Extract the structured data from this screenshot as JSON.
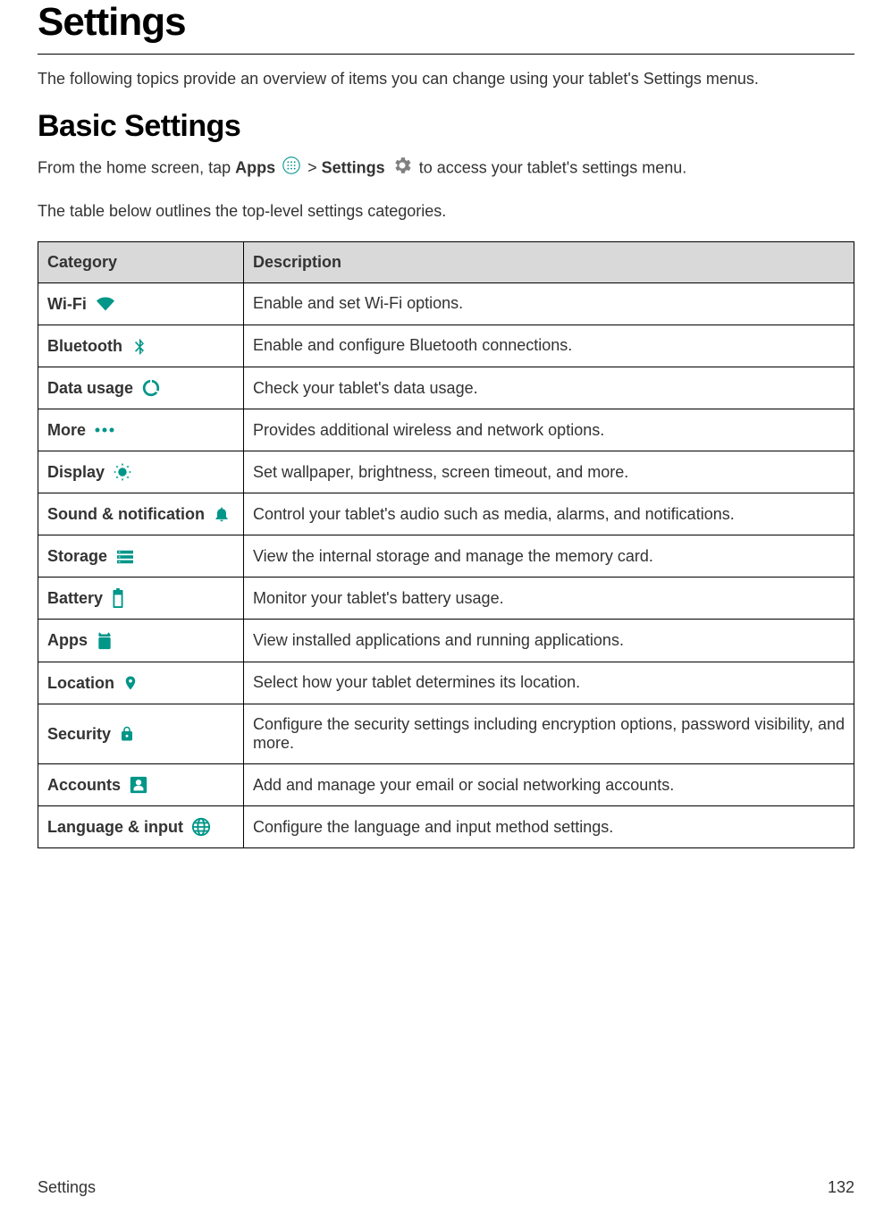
{
  "title": "Settings",
  "intro": "The following topics provide an overview of items you can change using your tablet's Settings menus.",
  "section_title": "Basic Settings",
  "step": {
    "prefix": "From the home screen, tap ",
    "apps_label": "Apps",
    "separator": " > ",
    "settings_label": "Settings",
    "suffix": "  to access your tablet's settings menu."
  },
  "table_intro": "The table below outlines the top-level settings categories.",
  "table": {
    "header_category": "Category",
    "header_description": "Description",
    "rows": [
      {
        "label": "Wi-Fi",
        "icon": "wifi-icon",
        "desc": "Enable and set Wi-Fi options."
      },
      {
        "label": "Bluetooth",
        "icon": "bluetooth-icon",
        "desc": "Enable and configure Bluetooth connections."
      },
      {
        "label": "Data usage",
        "icon": "data-usage-icon",
        "desc": "Check your tablet's data usage."
      },
      {
        "label": "More",
        "icon": "more-icon",
        "desc": "Provides additional wireless and network options."
      },
      {
        "label": "Display",
        "icon": "display-icon",
        "desc": "Set wallpaper, brightness, screen timeout, and more."
      },
      {
        "label": "Sound & notification",
        "icon": "notification-icon",
        "desc": "Control your tablet's audio such as media, alarms, and notifications."
      },
      {
        "label": "Storage",
        "icon": "storage-icon",
        "desc": "View the internal storage and manage the memory card."
      },
      {
        "label": "Battery",
        "icon": "battery-icon",
        "desc": "Monitor your tablet's battery usage."
      },
      {
        "label": "Apps",
        "icon": "apps-icon",
        "desc": "View installed applications and running applications."
      },
      {
        "label": "Location",
        "icon": "location-icon",
        "desc": "Select how your tablet determines its location."
      },
      {
        "label": "Security",
        "icon": "security-icon",
        "desc": "Configure the security settings including encryption options, password visibility, and more."
      },
      {
        "label": "Accounts",
        "icon": "accounts-icon",
        "desc": "Add and manage your email or social networking accounts."
      },
      {
        "label": "Language & input",
        "icon": "language-icon",
        "desc": "Configure the language and input method settings."
      }
    ]
  },
  "footer": {
    "left": "Settings",
    "right": "132"
  }
}
